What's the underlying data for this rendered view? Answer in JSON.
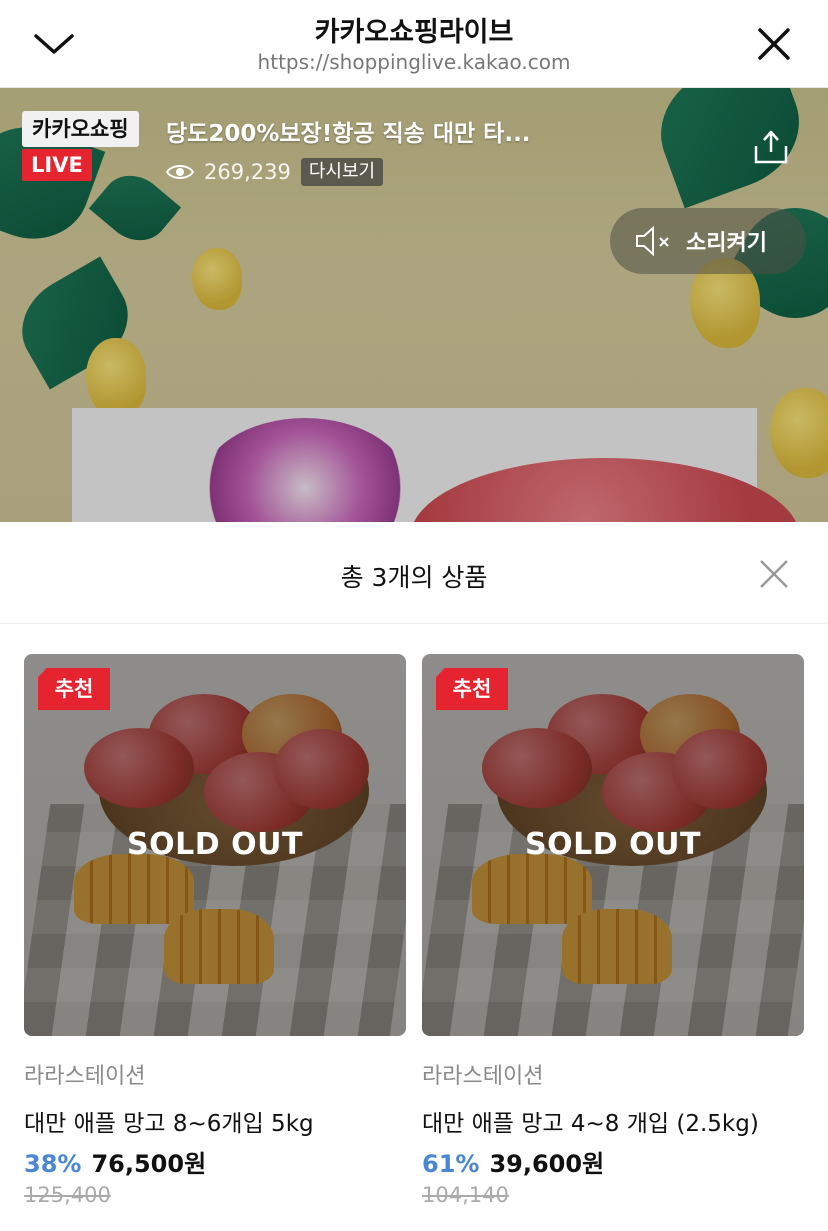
{
  "browser": {
    "title": "카카오쇼핑라이브",
    "url": "https://shoppinglive.kakao.com",
    "back_icon": "chevron-down-icon",
    "close_icon": "close-icon"
  },
  "video": {
    "channel_badge": "카카오쇼핑",
    "live_badge": "LIVE",
    "title": "당도200%보장!항공 직송 대만 타...",
    "view_count": "269,239",
    "replay_label": "다시보기",
    "sound_label": "소리켜기",
    "share_icon": "share-icon",
    "mute_icon": "mute-icon"
  },
  "sheet": {
    "title": "총 3개의 상품",
    "close_icon": "close-icon"
  },
  "products": [
    {
      "badge": "추천",
      "status": "SOLD OUT",
      "seller": "라라스테이션",
      "name": "대만 애플 망고 8~6개입 5kg",
      "discount": "38%",
      "price": "76,500원",
      "original_price": "125,400"
    },
    {
      "badge": "추천",
      "status": "SOLD OUT",
      "seller": "라라스테이션",
      "name": "대만 애플 망고 4~8 개입 (2.5kg)",
      "discount": "61%",
      "price": "39,600원",
      "original_price": "104,140"
    }
  ],
  "colors": {
    "live_red": "#e6242f",
    "discount_blue": "#4a86d6"
  }
}
